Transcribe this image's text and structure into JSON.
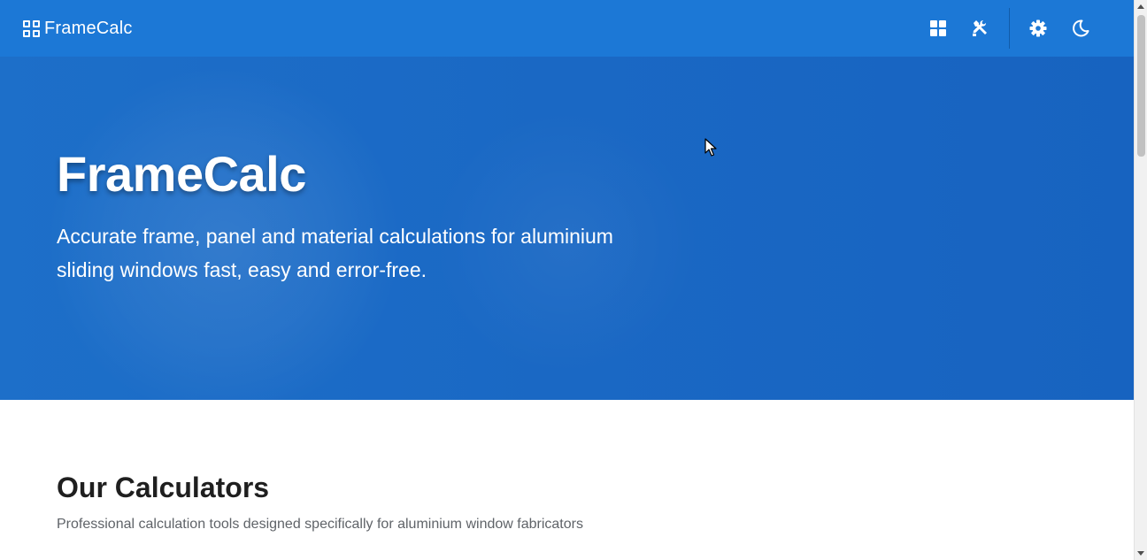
{
  "navbar": {
    "brand_name": "FrameCalc",
    "actions": {
      "dashboard": "dashboard-icon",
      "tools": "tools-icon",
      "settings": "gear-icon",
      "theme": "moon-icon"
    }
  },
  "hero": {
    "title": "FrameCalc",
    "subtitle": "Accurate frame, panel and material calculations for aluminium sliding windows fast, easy and error-free."
  },
  "calculators_section": {
    "title": "Our Calculators",
    "subtitle": "Professional calculation tools designed specifically for aluminium window fabricators"
  },
  "colors": {
    "navbar": "#1c78d6",
    "hero": "#1a68c4",
    "title_text": "#1f1f1f",
    "muted_text": "#5f6368"
  }
}
